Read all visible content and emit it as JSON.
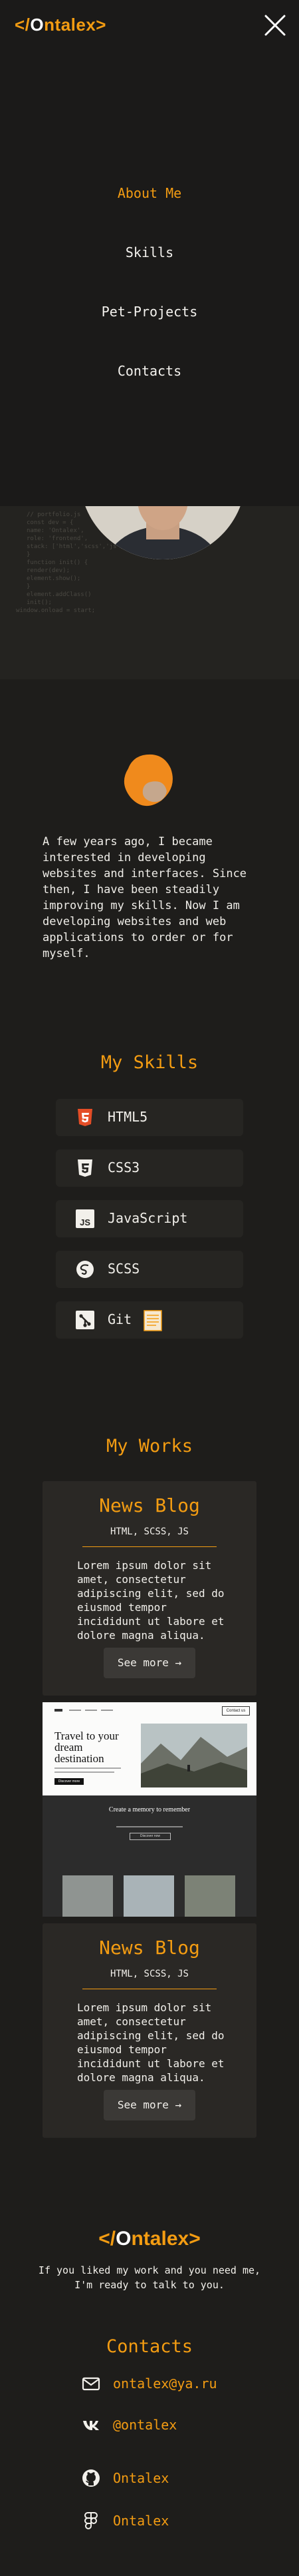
{
  "header": {
    "logo_prefix": "</",
    "logo_o": "O",
    "logo_rest": "ntalex>",
    "close_icon": "close-icon"
  },
  "nav": {
    "items": [
      {
        "label": "About Me",
        "active": true
      },
      {
        "label": "Skills",
        "active": false
      },
      {
        "label": "Pet-Projects",
        "active": false
      },
      {
        "label": "Contacts",
        "active": false
      }
    ]
  },
  "hero": {
    "code_lines": [
      "// portfolio.js",
      "const dev = {",
      "  name: 'Ontalex',",
      "  role: 'frontend',",
      "  stack: ['html','scss','js']",
      "}",
      "function init() {",
      "  render(dev);",
      "  element.show();",
      "}",
      "element.addClass()",
      "init();",
      "window.onload = start;"
    ]
  },
  "about": {
    "text": "A few years ago, I became interested in developing websites and interfaces. Since then, I have been steadily improving my skills. Now I am developing websites and web applications to order or for myself."
  },
  "skills": {
    "title": "My Skills",
    "items": [
      {
        "label": "HTML5",
        "icon": "html5-icon"
      },
      {
        "label": "CSS3",
        "icon": "css3-icon"
      },
      {
        "label": "JavaScript",
        "icon": "javascript-icon"
      },
      {
        "label": "SCSS",
        "icon": "sass-icon"
      },
      {
        "label": "Git",
        "icon": "git-icon"
      }
    ]
  },
  "works": {
    "title": "My Works",
    "cards": [
      {
        "title": "News Blog",
        "tags": "HTML, SCSS, JS",
        "text": "Lorem ipsum dolor sit amet, consectetur adipiscing elit, sed do eiusmod tempor incididunt ut labore et dolore magna aliqua.",
        "button": "See more →"
      },
      {
        "title": "News Blog",
        "tags": "HTML, SCSS, JS",
        "text": "Lorem ipsum dolor sit amet, consectetur adipiscing elit, sed do eiusmod tempor incididunt ut labore et dolore magna aliqua.",
        "button": "See more →"
      }
    ],
    "preview": {
      "hero_title": "Travel to your dream destination",
      "section_title": "Create a memory to remember",
      "nav_button": "Contact us",
      "cta": "Discover more",
      "section_button": "Discover now"
    }
  },
  "footer": {
    "logo_prefix": "</",
    "logo_o": "O",
    "logo_rest": "ntalex>",
    "text": "If you liked my work and you need me, I'm ready to talk to you.",
    "contacts_title": "Contacts",
    "contacts": [
      {
        "label": "ontalex@ya.ru",
        "icon": "mail-icon"
      },
      {
        "label": "@ontalex",
        "icon": "vk-icon"
      },
      {
        "label": "Ontalex",
        "icon": "github-icon"
      },
      {
        "label": "Ontalex",
        "icon": "figma-icon"
      }
    ]
  },
  "colors": {
    "accent": "#f39c12",
    "background": "#1e1d1b",
    "card": "#2a2825"
  }
}
